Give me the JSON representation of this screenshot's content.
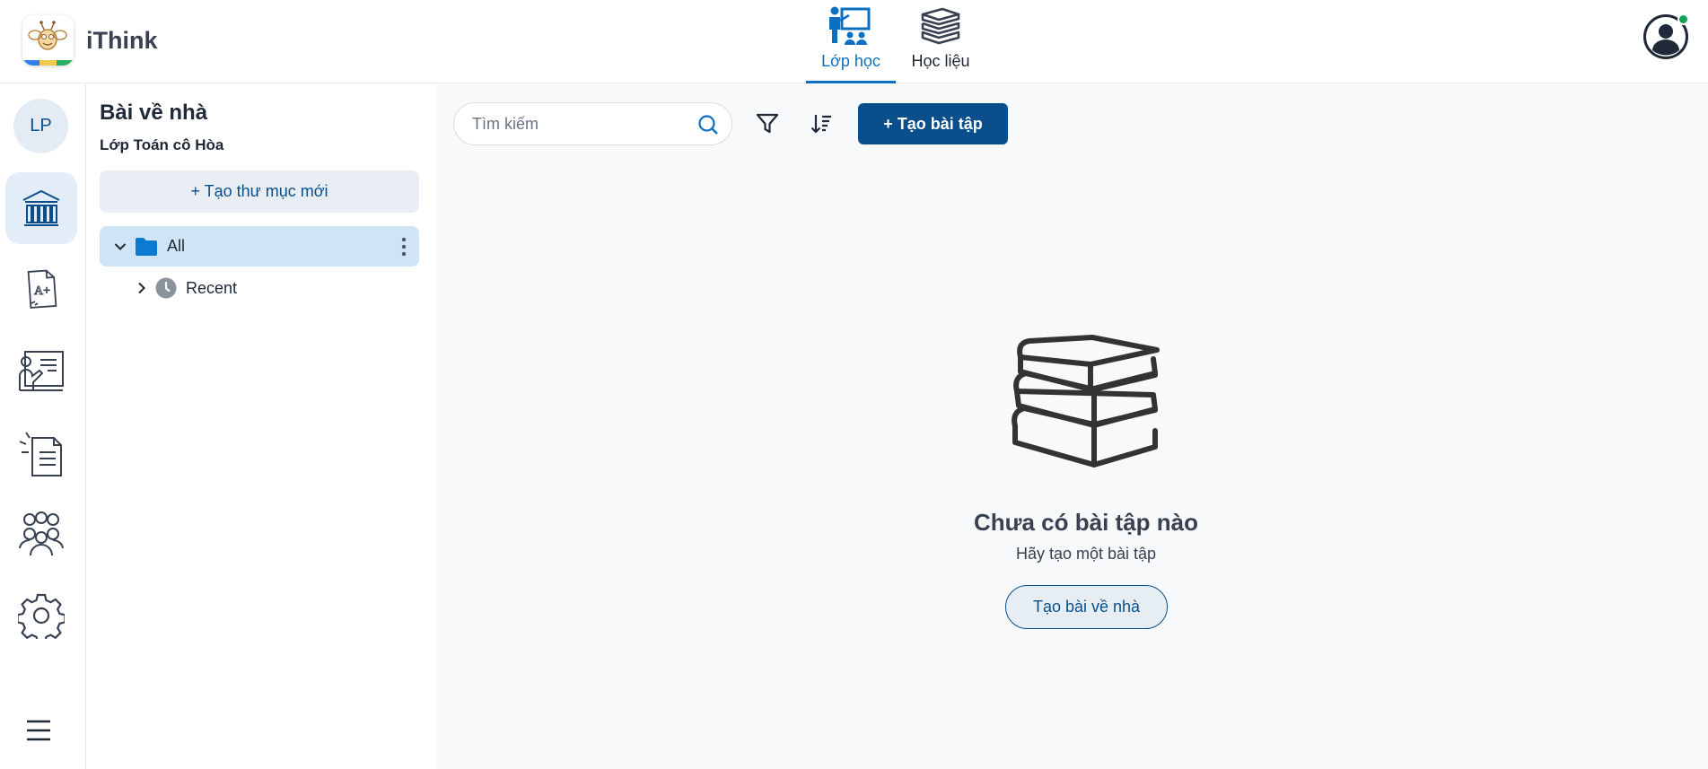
{
  "app": {
    "name": "iThink"
  },
  "nav": {
    "tabs": [
      {
        "label": "Lớp học",
        "active": true,
        "icon": "classroom-icon"
      },
      {
        "label": "Học liệu",
        "active": false,
        "icon": "books-icon"
      }
    ]
  },
  "profile": {
    "status": "online",
    "status_color": "#10a35a"
  },
  "rail": {
    "avatar_initials": "LP",
    "items": [
      {
        "name": "library",
        "icon": "library-icon",
        "active": true
      },
      {
        "name": "grades",
        "icon": "graded-paper-icon",
        "active": false
      },
      {
        "name": "teaching",
        "icon": "teacher-board-icon",
        "active": false
      },
      {
        "name": "documents",
        "icon": "document-icon",
        "active": false
      },
      {
        "name": "members",
        "icon": "group-icon",
        "active": false
      },
      {
        "name": "settings",
        "icon": "gear-icon",
        "active": false
      }
    ]
  },
  "folder_panel": {
    "title": "Bài về nhà",
    "subtitle": "Lớp Toán cô Hòa",
    "new_folder_label": "+ Tạo thư mục mới",
    "tree": [
      {
        "label": "All",
        "expanded": true,
        "selected": true
      },
      {
        "label": "Recent",
        "expanded": false,
        "selected": false
      }
    ]
  },
  "toolbar": {
    "search_placeholder": "Tìm kiếm",
    "create_label": "+ Tạo bài tập"
  },
  "empty_state": {
    "title": "Chưa có bài tập nào",
    "subtitle": "Hãy tạo một bài tập",
    "button_label": "Tạo bài về nhà"
  },
  "colors": {
    "primary": "#0a4f8c",
    "active_tab": "#0b6fc2",
    "selected_row": "#cfe5f6"
  }
}
